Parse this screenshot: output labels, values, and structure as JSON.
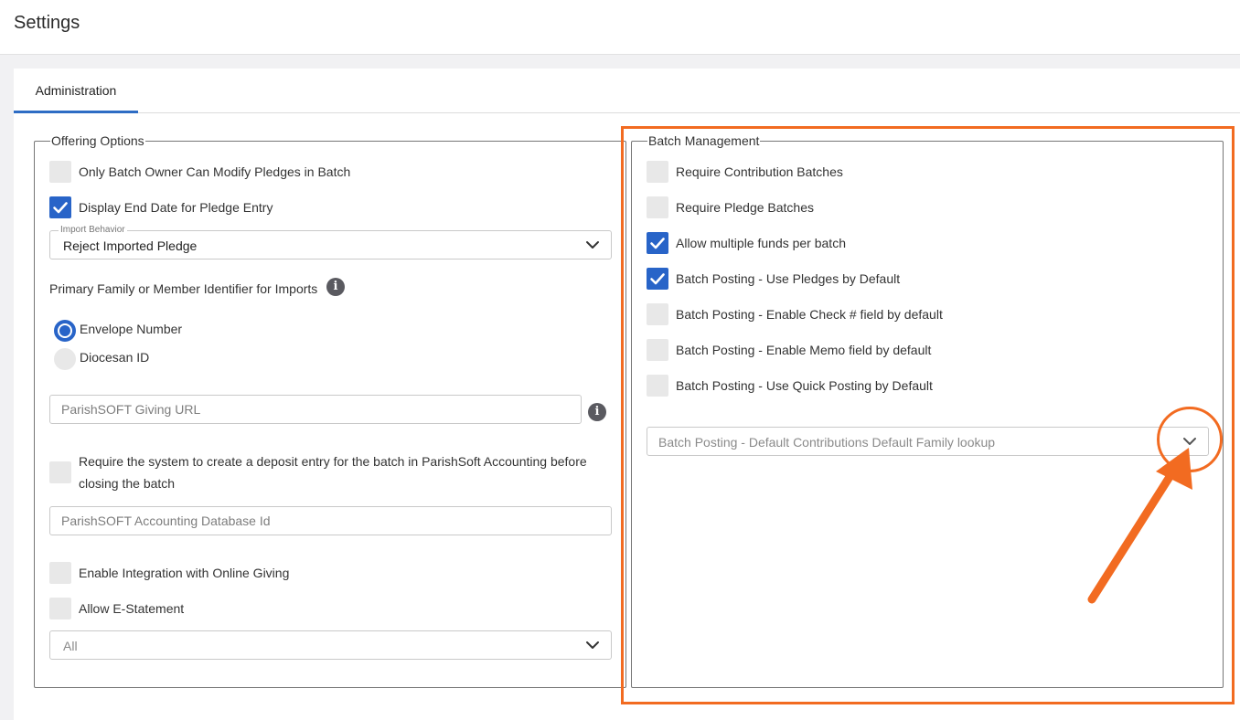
{
  "header": {
    "title": "Settings"
  },
  "tabs": [
    {
      "label": "Administration",
      "active": true
    }
  ],
  "offering": {
    "legend": "Offering Options",
    "only_batch_owner": {
      "label": "Only Batch Owner Can Modify Pledges in Batch",
      "checked": false
    },
    "display_end_date": {
      "label": "Display End Date for Pledge Entry",
      "checked": true
    },
    "import_behavior": {
      "floating_label": "Import Behavior",
      "value": "Reject Imported Pledge"
    },
    "identifier": {
      "label": "Primary Family or Member Identifier for Imports",
      "options": [
        {
          "label": "Envelope Number",
          "selected": true
        },
        {
          "label": "Diocesan ID",
          "selected": false
        }
      ]
    },
    "giving_url": {
      "placeholder": "ParishSOFT Giving URL"
    },
    "require_deposit": {
      "label_line1": "Require the system to create a deposit entry for the batch in ParishSoft Accounting before",
      "label_line2": "closing the batch",
      "checked": false
    },
    "accounting_db": {
      "placeholder": "ParishSOFT Accounting Database Id"
    },
    "online_giving": {
      "label": "Enable Integration with Online Giving",
      "checked": false
    },
    "e_statement": {
      "label": "Allow E-Statement",
      "checked": false
    },
    "estatement_select": {
      "value": "All"
    }
  },
  "batch": {
    "legend": "Batch Management",
    "items": [
      {
        "label": "Require Contribution Batches",
        "checked": false
      },
      {
        "label": "Require Pledge Batches",
        "checked": false
      },
      {
        "label": "Allow multiple funds per batch",
        "checked": true
      },
      {
        "label": "Batch Posting - Use Pledges by Default",
        "checked": true
      },
      {
        "label": "Batch Posting - Enable Check # field by default",
        "checked": false
      },
      {
        "label": "Batch Posting - Enable Memo field by default",
        "checked": false
      },
      {
        "label": "Batch Posting - Use Quick Posting by Default",
        "checked": false
      }
    ],
    "lookup_select": {
      "placeholder": "Batch Posting - Default Contributions Default Family lookup"
    }
  },
  "icons": {
    "check": "check-icon",
    "chevron": "chevron-down-icon",
    "info": "info-icon"
  },
  "colors": {
    "accent": "#2864c8",
    "annotation": "#f26b21"
  }
}
